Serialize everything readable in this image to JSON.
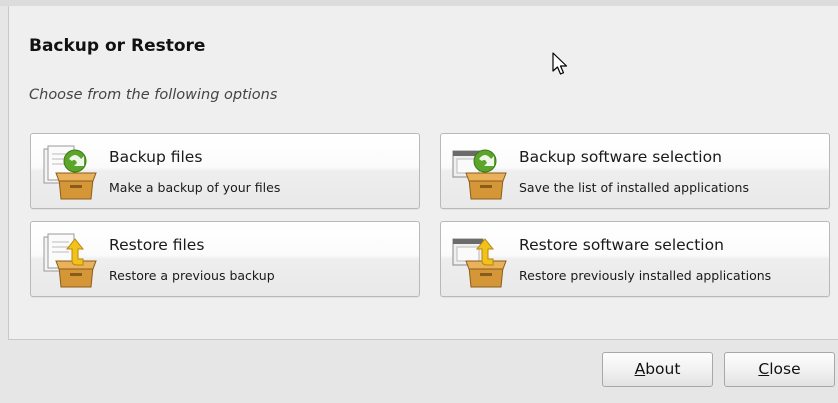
{
  "dialog": {
    "title": "Backup or Restore",
    "subtitle": "Choose from the following options"
  },
  "options": [
    {
      "title": "Backup files",
      "description": "Make a backup of your files",
      "icon": "backup-files-icon"
    },
    {
      "title": "Backup software selection",
      "description": "Save the list of installed applications",
      "icon": "backup-software-icon"
    },
    {
      "title": "Restore files",
      "description": "Restore a previous backup",
      "icon": "restore-files-icon"
    },
    {
      "title": "Restore software selection",
      "description": "Restore previously installed applications",
      "icon": "restore-software-icon"
    }
  ],
  "buttons": {
    "about": {
      "mnemonic": "A",
      "rest": "bout"
    },
    "close": {
      "mnemonic": "C",
      "rest": "lose"
    }
  },
  "colors": {
    "backup_arrow": "#5aa52a",
    "restore_arrow": "#f2c21a",
    "box": "#d49636"
  }
}
